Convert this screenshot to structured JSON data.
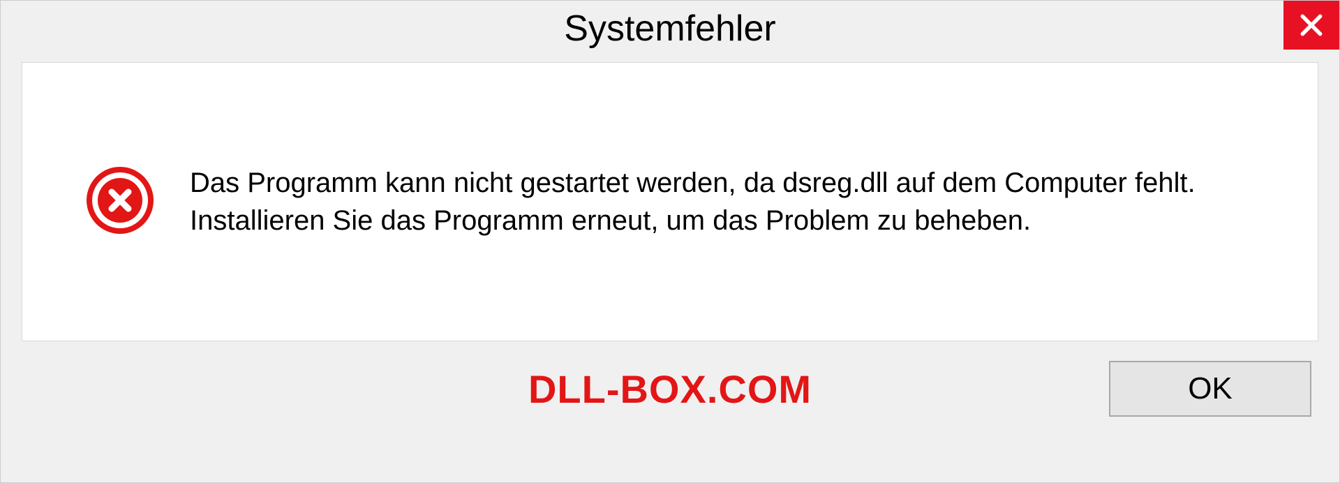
{
  "title": "Systemfehler",
  "message": "Das Programm kann nicht gestartet werden, da dsreg.dll auf dem Computer fehlt. Installieren Sie das Programm erneut, um das Problem zu beheben.",
  "watermark": "DLL-BOX.COM",
  "ok_label": "OK"
}
